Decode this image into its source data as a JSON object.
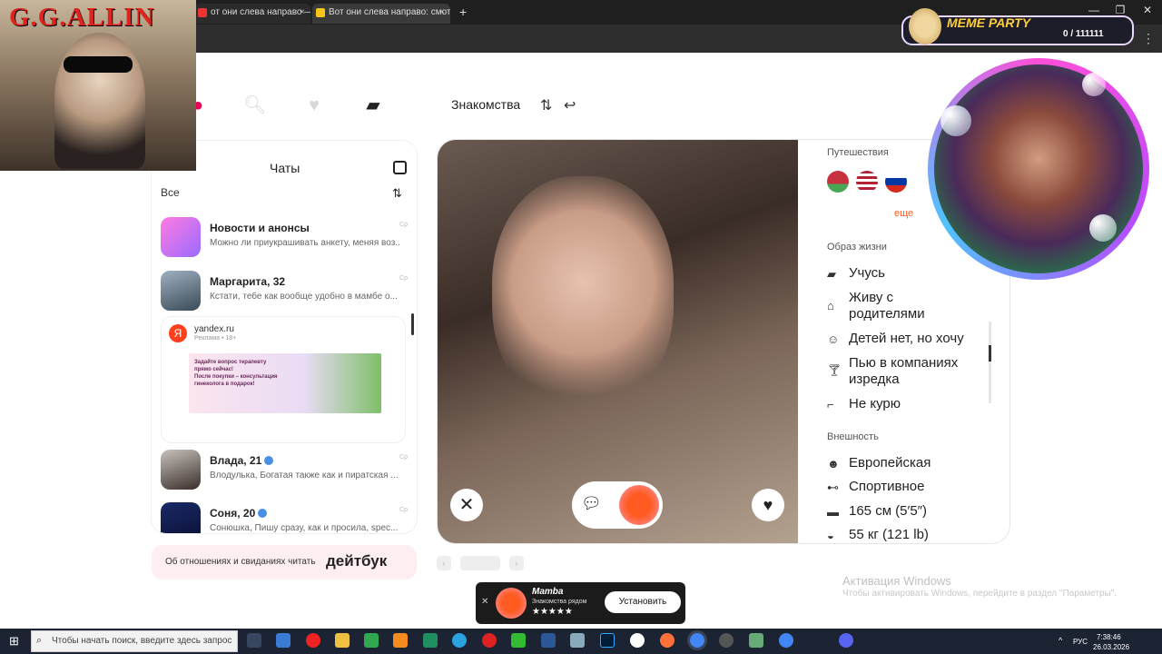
{
  "browser": {
    "tabs": [
      {
        "title": "от они слева направо — Янд"
      },
      {
        "title": "Вот они слева направо: смотр"
      }
    ],
    "new_tab": "+",
    "controls": [
      "—",
      "❐",
      "✕"
    ]
  },
  "nav": {
    "section_title": "Знакомства"
  },
  "chats": {
    "title": "Чаты",
    "filter_label": "Все",
    "items": [
      {
        "name": "Новости и анонсы",
        "preview": "Можно ли приукрашивать анкету, меняя воз...",
        "time": "Ср"
      },
      {
        "name": "Маргарита, 32",
        "preview": "Кстати, тебе как вообще удобно в мамбе о...",
        "time": "Ср"
      },
      {
        "name": "Влада, 21",
        "preview": "Влодулька, Богатая также как и пиратская ...",
        "time": "Ср"
      },
      {
        "name": "Соня, 20",
        "preview": "Сонюшка, Пишу сразу, как и просила, spec...",
        "time": "Ср"
      }
    ],
    "ad": {
      "domain": "yandex.ru",
      "sub": "Реклама • 18+",
      "logo": "Я",
      "banner_lines": [
        "Задайте вопрос терапевту",
        "прямо сейчас!",
        "После покупки – консультация",
        "гинеколога в подарок!"
      ]
    }
  },
  "banner": {
    "text": "Об отношениях и свиданиях читать",
    "brand": "дейтбук"
  },
  "profile": {
    "travel": {
      "heading": "Путешествия",
      "more": "еще"
    },
    "lifestyle": {
      "heading": "Образ жизни",
      "items": [
        "Учусь",
        "Живу с",
        "родителями",
        "Детей нет, но хочу",
        "Пью в компаниях",
        "изредка",
        "Не курю"
      ]
    },
    "appearance": {
      "heading": "Внешность",
      "items": [
        "Европейская",
        "Спортивное",
        "165 см (5′5″)",
        "55 кг (121 lb)"
      ]
    }
  },
  "toast": {
    "app": "Mamba",
    "tagline": "Знакомства рядом",
    "rating": "★★★★★",
    "install": "Установить",
    "close": "✕"
  },
  "windows": {
    "activate_title": "Активация Windows",
    "activate_sub": "Чтобы активировать Windows, перейдите в раздел \"Параметры\".",
    "search_placeholder": "Чтобы начать поиск, введите здесь запрос",
    "lang": "РУС",
    "time": "7:38:46",
    "date": "26.03.2026"
  },
  "overlays": {
    "poster_title": "G.G.ALLIN",
    "meme_party": "MEME PARTY",
    "counter": "0 / 111111"
  },
  "colors": {
    "accent_orange": "#ff5a1f",
    "verified_blue": "#4a90e2",
    "banner_pink": "#fdeef1"
  }
}
